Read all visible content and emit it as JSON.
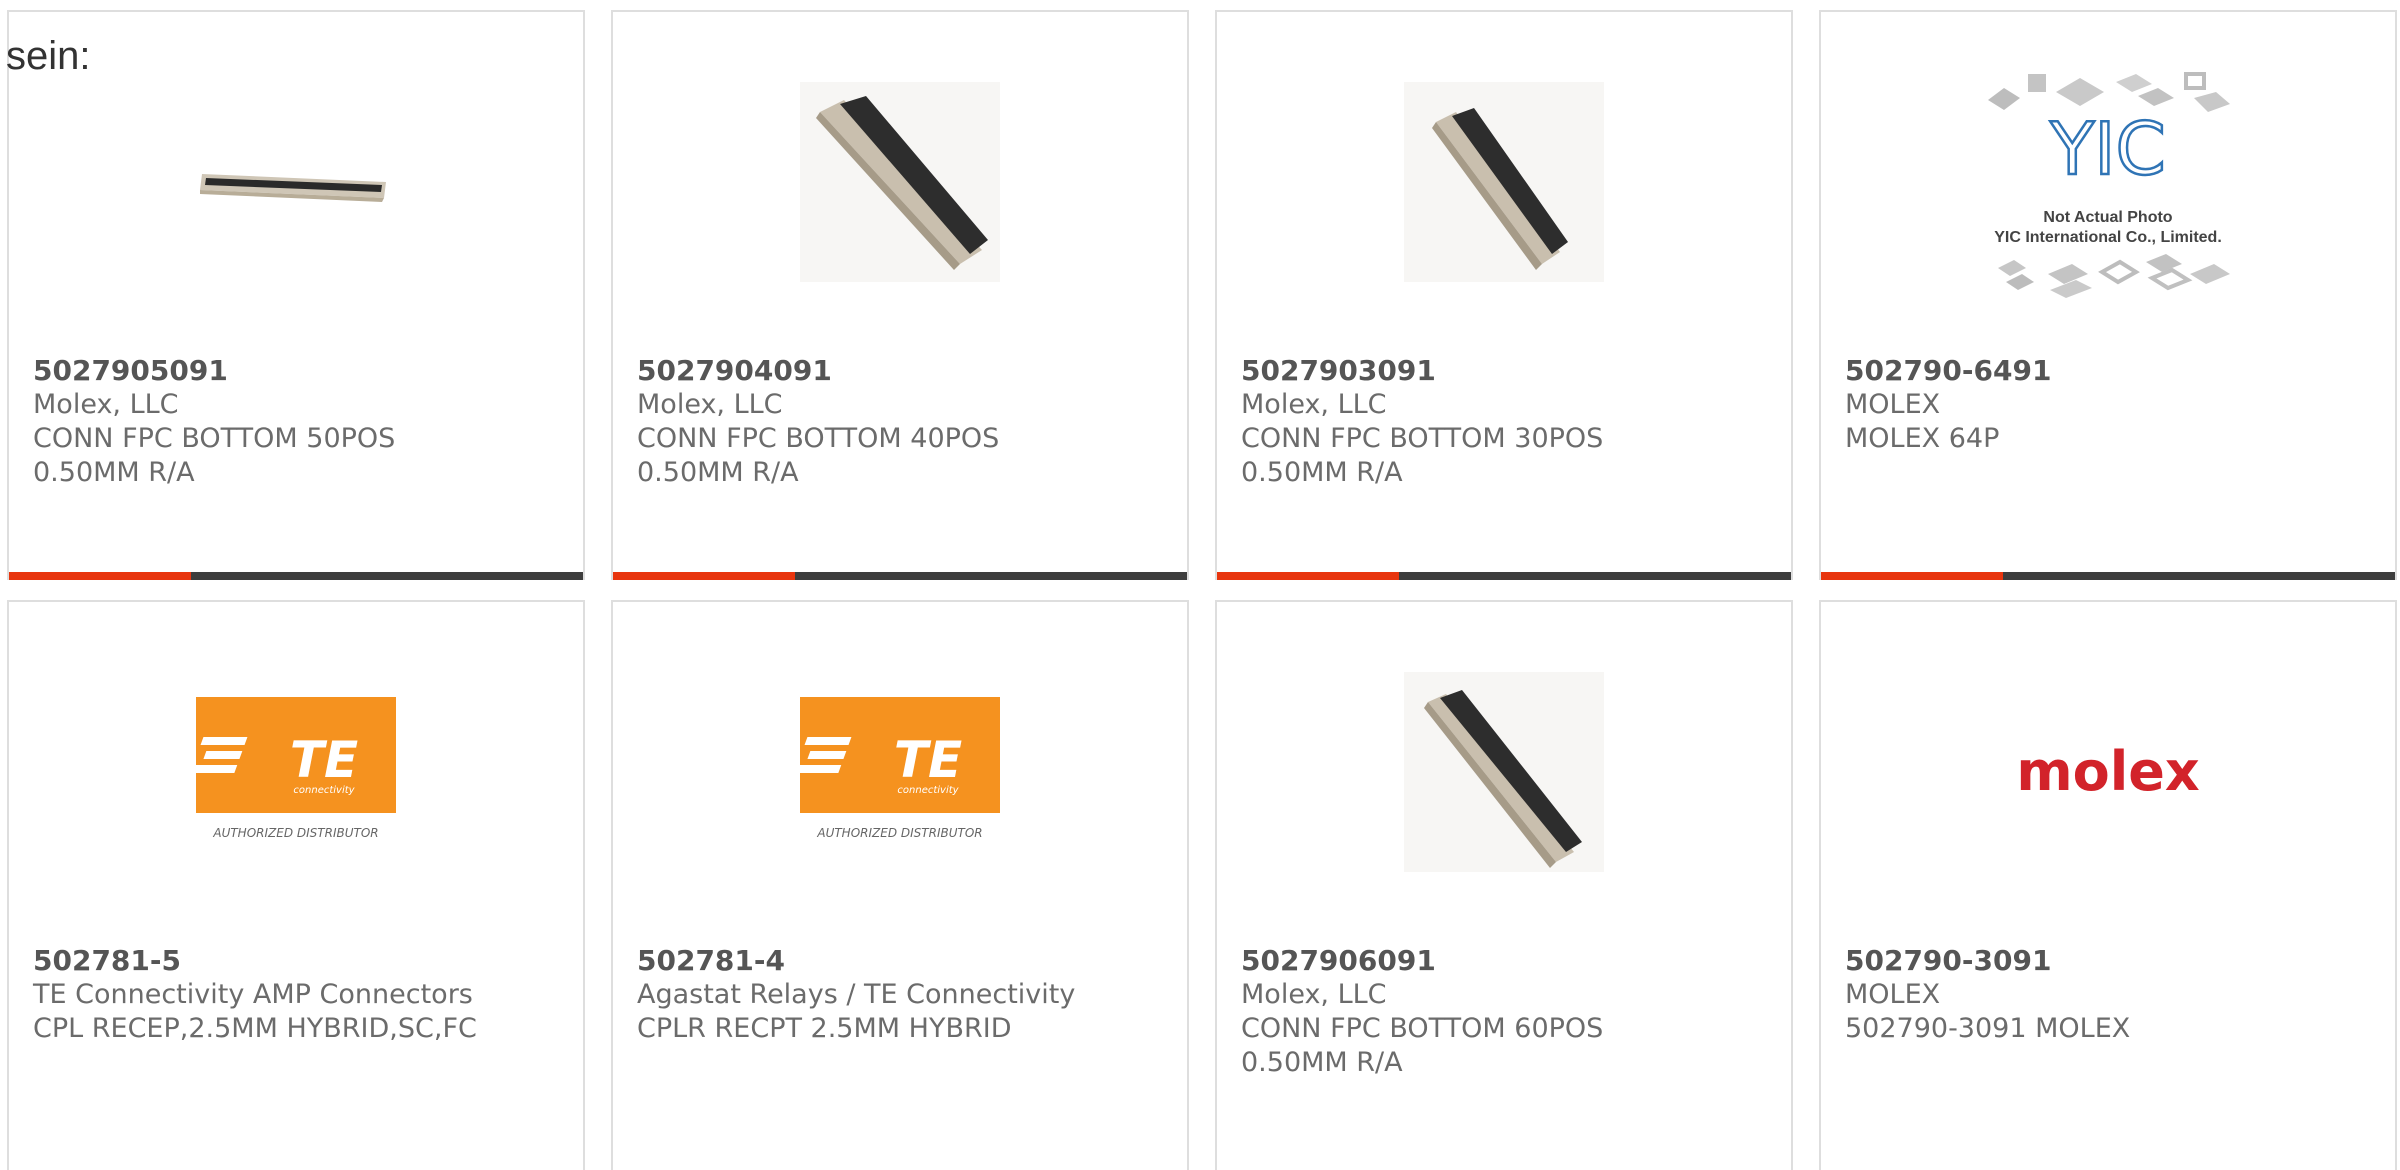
{
  "intro_text": "sein:",
  "accent_color": "#e8350e",
  "bar_color": "#3d3d3d",
  "products": [
    {
      "part": "5027905091",
      "line1": "Molex, LLC",
      "line2": "CONN FPC BOTTOM 50POS",
      "line3": "0.50MM R/A",
      "image": "fpc-connector-flat"
    },
    {
      "part": "5027904091",
      "line1": "Molex, LLC",
      "line2": "CONN FPC BOTTOM 40POS",
      "line3": "0.50MM R/A",
      "image": "fpc-connector-angled"
    },
    {
      "part": "5027903091",
      "line1": "Molex, LLC",
      "line2": "CONN FPC BOTTOM 30POS",
      "line3": "0.50MM R/A",
      "image": "fpc-connector-angled"
    },
    {
      "part": "502790-6491",
      "line1": "MOLEX",
      "line2": "MOLEX 64P",
      "line3": "",
      "image": "yic-placeholder",
      "image_text": {
        "logo": "YIC",
        "caption1": "Not Actual Photo",
        "caption2": "YIC International Co., Limited."
      }
    },
    {
      "part": "502781-5",
      "line1": "TE Connectivity AMP Connectors",
      "line2": "CPL RECEP,2.5MM HYBRID,SC,FC",
      "line3": "",
      "image": "te-logo",
      "image_text": {
        "logo": "TE",
        "sub": "connectivity",
        "caption": "AUTHORIZED DISTRIBUTOR"
      }
    },
    {
      "part": "502781-4",
      "line1": "Agastat Relays / TE Connectivity",
      "line2": "CPLR RECPT 2.5MM HYBRID",
      "line3": "",
      "image": "te-logo",
      "image_text": {
        "logo": "TE",
        "sub": "connectivity",
        "caption": "AUTHORIZED DISTRIBUTOR"
      }
    },
    {
      "part": "5027906091",
      "line1": "Molex, LLC",
      "line2": "CONN FPC BOTTOM 60POS",
      "line3": "0.50MM R/A",
      "image": "fpc-connector-angled"
    },
    {
      "part": "502790-3091",
      "line1": "MOLEX",
      "line2": "502790-3091 MOLEX",
      "line3": "",
      "image": "molex-logo",
      "image_text": {
        "logo": "molex"
      }
    }
  ]
}
